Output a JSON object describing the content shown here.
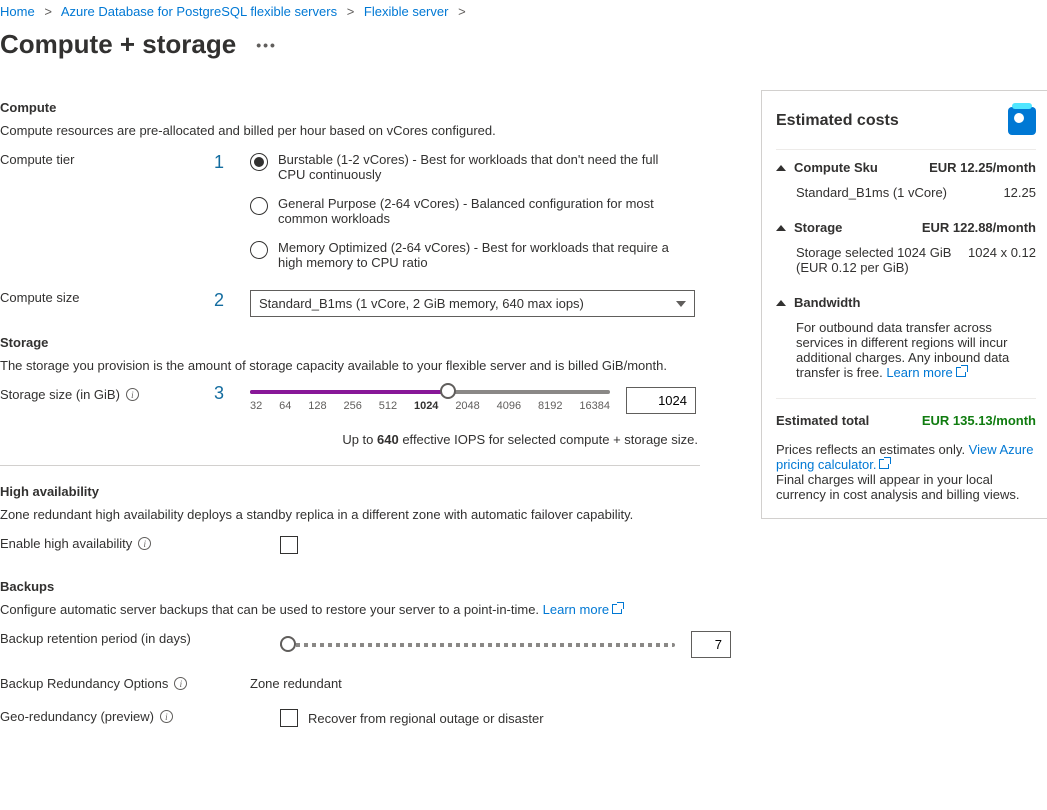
{
  "breadcrumb": {
    "items": [
      "Home",
      "Azure Database for PostgreSQL flexible servers",
      "Flexible server"
    ]
  },
  "page": {
    "title": "Compute + storage"
  },
  "annotations": {
    "one": "1",
    "two": "2",
    "three": "3"
  },
  "compute": {
    "heading": "Compute",
    "desc": "Compute resources are pre-allocated and billed per hour based on vCores configured.",
    "tier_label": "Compute tier",
    "tiers": [
      {
        "label": "Burstable (1-2 vCores) - Best for workloads that don't need the full CPU continuously"
      },
      {
        "label": "General Purpose (2-64 vCores) - Balanced configuration for most common workloads"
      },
      {
        "label": "Memory Optimized (2-64 vCores) - Best for workloads that require a high memory to CPU ratio"
      }
    ],
    "size_label": "Compute size",
    "size_value": "Standard_B1ms (1 vCore, 2 GiB memory, 640 max iops)"
  },
  "storage": {
    "heading": "Storage",
    "desc": "The storage you provision is the amount of storage capacity available to your flexible server and is billed GiB/month.",
    "size_label": "Storage size (in GiB)",
    "ticks": [
      "32",
      "64",
      "128",
      "256",
      "512",
      "1024",
      "2048",
      "4096",
      "8192",
      "16384"
    ],
    "selected_tick": "1024",
    "value": "1024",
    "iops_prefix": "Up to ",
    "iops_bold": "640",
    "iops_suffix": " effective IOPS for selected compute + storage size."
  },
  "ha": {
    "heading": "High availability",
    "desc": "Zone redundant high availability deploys a standby replica in a different zone with automatic failover capability.",
    "enable_label": "Enable high availability"
  },
  "backups": {
    "heading": "Backups",
    "desc_prefix": "Configure automatic server backups that can be used to restore your server to a point-in-time. ",
    "learn_more": "Learn more",
    "retention_label": "Backup retention period (in days)",
    "retention_value": "7",
    "redundancy_label": "Backup Redundancy Options",
    "redundancy_value": "Zone redundant",
    "geo_label": "Geo-redundancy (preview)",
    "geo_checkbox_label": "Recover from regional outage or disaster"
  },
  "costs": {
    "title": "Estimated costs",
    "compute_sku": {
      "label": "Compute Sku",
      "price": "EUR 12.25/month",
      "detail": "Standard_B1ms (1 vCore)",
      "detail_price": "12.25"
    },
    "storage": {
      "label": "Storage",
      "price": "EUR 122.88/month",
      "detail": "Storage selected 1024 GiB (EUR 0.12 per GiB)",
      "detail_price": "1024 x 0.12"
    },
    "bandwidth": {
      "label": "Bandwidth",
      "desc_prefix": "For outbound data transfer across services in different regions will incur additional charges. Any inbound data transfer is free. ",
      "learn_more": "Learn more"
    },
    "total": {
      "label": "Estimated total",
      "price": "EUR 135.13/month"
    },
    "footer": {
      "p1a": "Prices reflects an estimates only. ",
      "link1": "View Azure pricing calculator.",
      "p2": "Final charges will appear in your local currency in cost analysis and billing views."
    }
  }
}
